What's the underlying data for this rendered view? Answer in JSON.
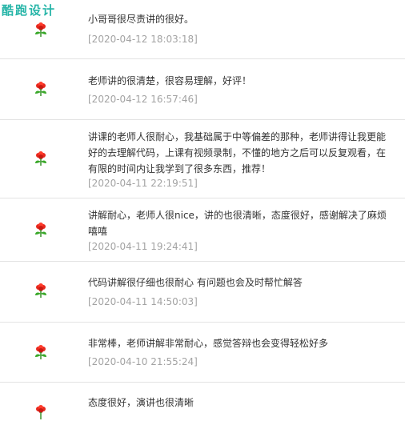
{
  "watermark": "酷跑设计",
  "icon": "red-flower-icon",
  "comments": [
    {
      "text": "小哥哥很尽责讲的很好。",
      "time": "[2020-04-12 18:03:18]"
    },
    {
      "text": "老师讲的很清楚，很容易理解，好评！",
      "time": "[2020-04-12 16:57:46]"
    },
    {
      "text": "讲课的老师人很耐心，我基础属于中等偏差的那种，老师讲得让我更能好的去理解代码，上课有视频录制，不懂的地方之后可以反复观看，在有限的时间内让我学到了很多东西，推荐！",
      "time": "[2020-04-11 22:19:51]"
    },
    {
      "text": "讲解耐心，老师人很nice，讲的也很清晰，态度很好，感谢解决了麻烦嘻嘻",
      "time": "[2020-04-11 19:24:41]"
    },
    {
      "text": "代码讲解很仔细也很耐心 有问题也会及时帮忙解答",
      "time": "[2020-04-11 14:50:03]"
    },
    {
      "text": "非常棒，老师讲解非常耐心，感觉答辩也会变得轻松好多",
      "time": "[2020-04-10 21:55:24]"
    },
    {
      "text": "态度很好，演讲也很清晰",
      "time": ""
    }
  ]
}
